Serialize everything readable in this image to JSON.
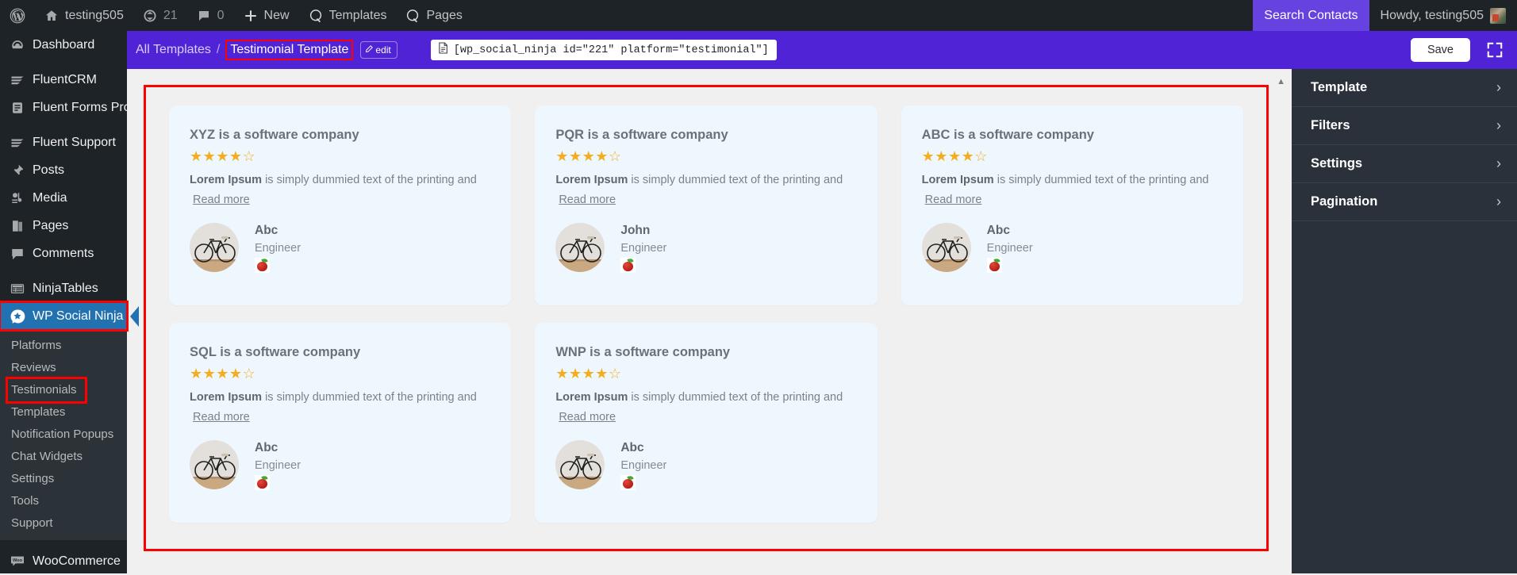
{
  "adminbar": {
    "wp_logo": "wordpress-icon",
    "site_name": "testing505",
    "updates_count": "21",
    "comments_count": "0",
    "new_label": "New",
    "templates_label": "Templates",
    "pages_label": "Pages",
    "search_contacts": "Search Contacts",
    "howdy": "Howdy, testing505"
  },
  "sidebar": {
    "items": [
      {
        "label": "Dashboard",
        "icon": "dashboard-icon"
      },
      {
        "label": "FluentCRM",
        "icon": "fluentcrm-icon"
      },
      {
        "label": "Fluent Forms Pro",
        "icon": "fluent-forms-icon"
      },
      {
        "label": "Fluent Support",
        "icon": "fluent-support-icon"
      },
      {
        "label": "Posts",
        "icon": "pin-icon"
      },
      {
        "label": "Media",
        "icon": "media-icon"
      },
      {
        "label": "Pages",
        "icon": "pages-icon"
      },
      {
        "label": "Comments",
        "icon": "comment-icon"
      },
      {
        "label": "NinjaTables",
        "icon": "table-icon"
      }
    ],
    "active_item": {
      "label": "WP Social Ninja",
      "icon": "social-ninja-icon"
    },
    "submenu": [
      "Platforms",
      "Reviews",
      "Testimonials",
      "Templates",
      "Notification Popups",
      "Chat Widgets",
      "Settings",
      "Tools",
      "Support"
    ],
    "active_submenu": "Testimonials",
    "woocommerce": {
      "label": "WooCommerce",
      "icon": "woocommerce-icon"
    }
  },
  "topbar": {
    "breadcrumb_root": "All Templates",
    "breadcrumb_sep": "/",
    "breadcrumb_current": "Testimonial Template",
    "edit_label": "edit",
    "edit_icon": "pencil-icon",
    "shortcode_icon": "document-icon",
    "shortcode": "[wp_social_ninja id=\"221\" platform=\"testimonial\"]",
    "save_label": "Save",
    "expand_icon": "fullscreen-icon",
    "accent_color": "#5024d6"
  },
  "rightpanel": {
    "rows": [
      {
        "label": "Template",
        "chevron": "chevron-right-icon"
      },
      {
        "label": "Filters",
        "chevron": "chevron-right-icon"
      },
      {
        "label": "Settings",
        "chevron": "chevron-right-icon"
      },
      {
        "label": "Pagination",
        "chevron": "chevron-right-icon"
      }
    ]
  },
  "content": {
    "highlight_color": "#ff0000",
    "card_bg": "#eff7fe",
    "star_color": "#f5ad1d",
    "scroll_up_icon": "scroll-up-icon",
    "cards": [
      {
        "title": "XYZ is a software company",
        "rating": 4,
        "max_rating": 5,
        "body_bold": "Lorem Ipsum",
        "body_rest": " is simply dummied text of the printing and",
        "read_more": "Read more",
        "name": "Abc",
        "role": "Engineer",
        "emoji": "red-apple-emoji",
        "avatar": "bicycle-photo-avatar"
      },
      {
        "title": "PQR is a software company",
        "rating": 4,
        "max_rating": 5,
        "body_bold": "Lorem Ipsum",
        "body_rest": " is simply dummied text of the printing and",
        "read_more": "Read more",
        "name": "John",
        "role": "Engineer",
        "emoji": "red-apple-emoji",
        "avatar": "bicycle-photo-avatar"
      },
      {
        "title": "ABC is a software company",
        "rating": 4,
        "max_rating": 5,
        "body_bold": "Lorem Ipsum",
        "body_rest": " is simply dummied text of the printing and",
        "read_more": "Read more",
        "name": "Abc",
        "role": "Engineer",
        "emoji": "red-apple-emoji",
        "avatar": "bicycle-photo-avatar"
      },
      {
        "title": "SQL is a software company",
        "rating": 4,
        "max_rating": 5,
        "body_bold": "Lorem Ipsum",
        "body_rest": " is simply dummied text of the printing and",
        "read_more": "Read more",
        "name": "Abc",
        "role": "Engineer",
        "emoji": "red-apple-emoji",
        "avatar": "bicycle-photo-avatar"
      },
      {
        "title": "WNP is a software company",
        "rating": 4,
        "max_rating": 5,
        "body_bold": "Lorem Ipsum",
        "body_rest": " is simply dummied text of the printing and",
        "read_more": "Read more",
        "name": "Abc",
        "role": "Engineer",
        "emoji": "red-apple-emoji",
        "avatar": "bicycle-photo-avatar"
      }
    ]
  }
}
